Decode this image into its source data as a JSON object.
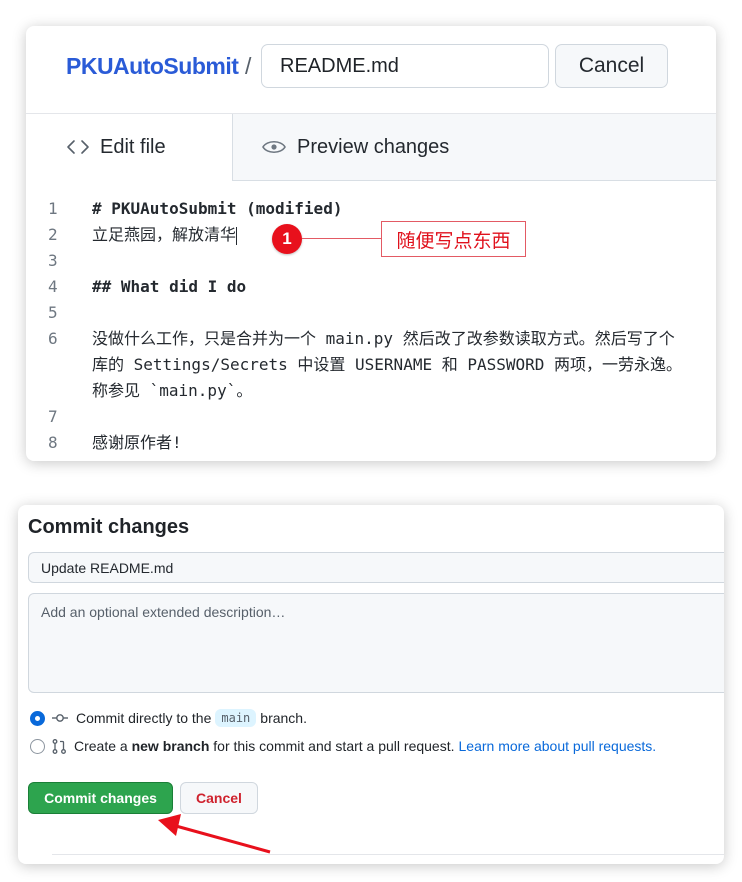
{
  "editor": {
    "repo_name": "PKUAutoSubmit",
    "separator": "/",
    "filename": "README.md",
    "cancel_label": "Cancel",
    "tabs": [
      {
        "label": "Edit file",
        "icon": "code-icon",
        "active": true
      },
      {
        "label": "Preview changes",
        "icon": "eye-icon",
        "active": false
      }
    ],
    "lines": [
      {
        "num": "1",
        "text": "# PKUAutoSubmit (modified)",
        "bold": true
      },
      {
        "num": "2",
        "text": "立足燕园，解放清华",
        "bold": false
      },
      {
        "num": "3",
        "text": "",
        "bold": false
      },
      {
        "num": "4",
        "text": "## What did I do",
        "bold": true
      },
      {
        "num": "5",
        "text": "",
        "bold": false
      },
      {
        "num": "6",
        "text_lines": [
          "没做什么工作，只是合并为一个 main.py 然后改了改参数读取方式。然后写了个",
          "库的 Settings/Secrets 中设置 USERNAME 和 PASSWORD 两项，一劳永逸。",
          "称参见 `main.py`。"
        ]
      },
      {
        "num": "7",
        "text": "",
        "bold": false
      },
      {
        "num": "8",
        "text": "感谢原作者!",
        "bold": false
      }
    ]
  },
  "annotation": {
    "marker": "1",
    "label": "随便写点东西",
    "color": "#e0111c"
  },
  "commit": {
    "title": "Commit changes",
    "summary_value": "Update README.md",
    "description_placeholder": "Add an optional extended description…",
    "option_direct": {
      "prefix": "Commit directly to the",
      "branch": "main",
      "suffix": "branch.",
      "checked": true
    },
    "option_new_branch": {
      "prefix": "Create a",
      "bold": "new branch",
      "suffix": "for this commit and start a pull request.",
      "link": "Learn more about pull requests.",
      "checked": false
    },
    "commit_button": "Commit changes",
    "cancel_button": "Cancel"
  },
  "colors": {
    "link": "#2a5bd7",
    "primary_green": "#2da44e",
    "danger": "#cf222e",
    "annotation_red": "#e8101c"
  }
}
